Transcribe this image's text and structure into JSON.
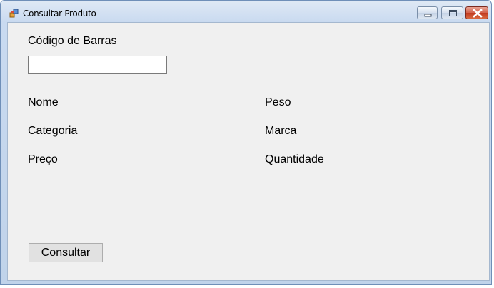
{
  "window": {
    "title": "Consultar Produto"
  },
  "titlebar_controls": {
    "minimize_icon": "minimize-icon",
    "maximize_icon": "maximize-icon",
    "close_icon": "close-icon"
  },
  "form": {
    "barcode_label": "Código de Barras",
    "barcode_value": "",
    "fields_left": [
      "Nome",
      "Categoria",
      "Preço"
    ],
    "fields_right": [
      "Peso",
      "Marca",
      "Quantidade"
    ],
    "consult_button_label": "Consultar"
  },
  "colors": {
    "client_background": "#f0f0f0",
    "close_button": "#c13b21",
    "frame": "#c0d3ea"
  }
}
